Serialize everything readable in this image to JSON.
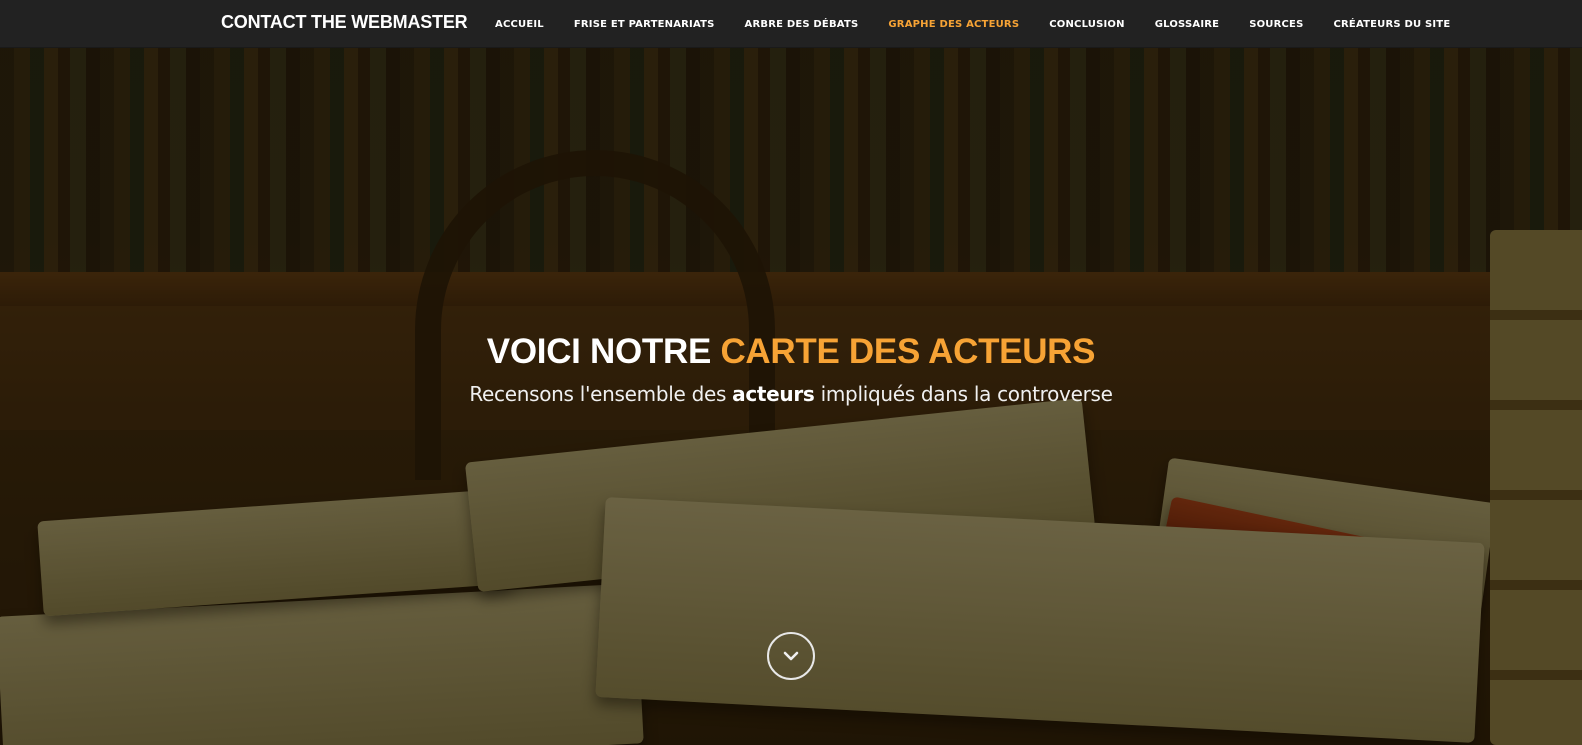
{
  "navbar": {
    "brand": "CONTACT THE WEBMASTER",
    "items": [
      {
        "label": "ACCUEIL",
        "active": false
      },
      {
        "label": "FRISE ET PARTENARIATS",
        "active": false
      },
      {
        "label": "ARBRE DES DÉBATS",
        "active": false
      },
      {
        "label": "GRAPHE DES ACTEURS",
        "active": true
      },
      {
        "label": "CONCLUSION",
        "active": false
      },
      {
        "label": "GLOSSAIRE",
        "active": false
      },
      {
        "label": "SOURCES",
        "active": false
      },
      {
        "label": "CRÉATEURS DU SITE",
        "active": false
      }
    ]
  },
  "hero": {
    "headline_prefix": "VOICI NOTRE",
    "headline_accent": "CARTE DES ACTEURS",
    "subline_before": "Recensons l'ensemble des",
    "subline_bold": "acteurs",
    "subline_after": "impliqués dans la controverse",
    "scroll_icon": "chevron-down-icon"
  },
  "colors": {
    "navbar_bg": "#222222",
    "accent": "#f7a335",
    "text": "#ffffff"
  }
}
